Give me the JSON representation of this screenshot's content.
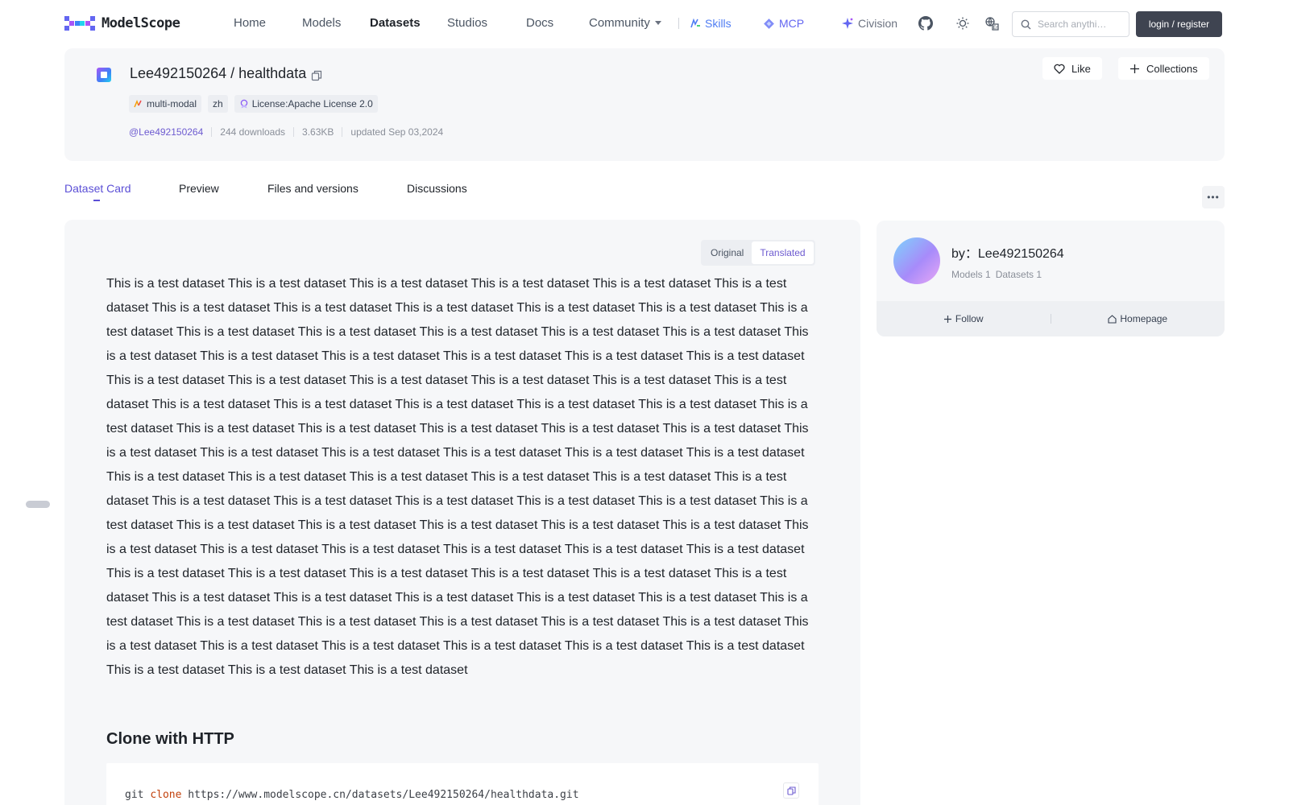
{
  "brand": {
    "name": "ModelScope"
  },
  "nav": {
    "items": [
      {
        "label": "Home"
      },
      {
        "label": "Models"
      },
      {
        "label": "Datasets"
      },
      {
        "label": "Studios"
      },
      {
        "label": "Docs"
      },
      {
        "label": "Community"
      }
    ],
    "skills": "Skills",
    "mcp": "MCP",
    "civision": "Civision",
    "search_placeholder": "Search anythi…",
    "login": "login / register"
  },
  "dataset": {
    "owner": "Lee492150264",
    "name": "healthdata",
    "title": "Lee492150264 / healthdata",
    "tags": [
      {
        "label": "multi-modal",
        "icon": "multimodal-icon"
      },
      {
        "label": "zh"
      },
      {
        "label": "License:Apache License 2.0",
        "icon": "license-icon"
      }
    ],
    "author_handle": "@Lee492150264",
    "downloads": "244 downloads",
    "size": "3.63KB",
    "updated": "updated Sep 03,2024",
    "like_label": "Like",
    "collections_label": "Collections"
  },
  "tabs": [
    {
      "label": "Dataset Card",
      "active": true
    },
    {
      "label": "Preview"
    },
    {
      "label": "Files and versions"
    },
    {
      "label": "Discussions"
    }
  ],
  "card": {
    "toggle": {
      "original": "Original",
      "translated": "Translated"
    },
    "description": "This is a test dataset This is a test dataset This is a test dataset This is a test dataset This is a test dataset This is a test dataset This is a test dataset This is a test dataset This is a test dataset This is a test dataset This is a test dataset This is a test dataset This is a test dataset This is a test dataset This is a test dataset This is a test dataset This is a test dataset This is a test dataset This is a test dataset This is a test dataset This is a test dataset This is a test dataset This is a test dataset This is a test dataset This is a test dataset This is a test dataset This is a test dataset This is a test dataset This is a test dataset This is a test dataset This is a test dataset This is a test dataset This is a test dataset This is a test dataset This is a test dataset This is a test dataset This is a test dataset This is a test dataset This is a test dataset This is a test dataset This is a test dataset This is a test dataset This is a test dataset This is a test dataset This is a test dataset This is a test dataset This is a test dataset This is a test dataset This is a test dataset This is a test dataset This is a test dataset This is a test dataset This is a test dataset This is a test dataset This is a test dataset This is a test dataset This is a test dataset This is a test dataset This is a test dataset This is a test dataset This is a test dataset This is a test dataset This is a test dataset This is a test dataset This is a test dataset This is a test dataset This is a test dataset This is a test dataset This is a test dataset This is a test dataset This is a test dataset This is a test dataset This is a test dataset This is a test dataset This is a test dataset This is a test dataset This is a test dataset This is a test dataset This is a test dataset This is a test dataset This is a test dataset This is a test dataset This is a test dataset This is a test dataset This is a test dataset This is a test dataset This is a test dataset This is a test dataset This is a test dataset This is a test dataset This is a test dataset This is a test dataset This is a test dataset This is a test dataset This is a test dataset",
    "clone_title": "Clone with HTTP",
    "clone_cmd": "git",
    "clone_kw": "clone",
    "clone_url": "https://www.modelscope.cn/datasets/Lee492150264/healthdata.git"
  },
  "author_card": {
    "by_label": "by：Lee492150264",
    "models": "Models 1",
    "datasets": "Datasets 1",
    "follow": "Follow",
    "homepage": "Homepage"
  },
  "colors": {
    "accent": "#5b4fd6",
    "login_bg": "#3f4451",
    "card_bg": "#f6f7f9"
  }
}
